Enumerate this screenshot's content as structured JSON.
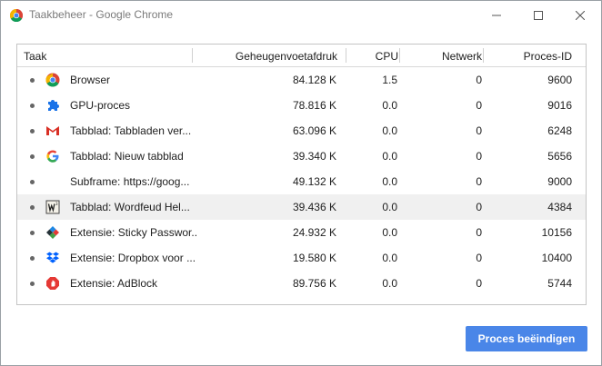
{
  "window": {
    "title": "Taakbeheer - Google Chrome"
  },
  "columns": {
    "task": "Taak",
    "memory": "Geheugenvoetafdruk",
    "cpu": "CPU",
    "network": "Netwerk",
    "pid": "Proces-ID"
  },
  "rows": [
    {
      "icon": "chrome-icon",
      "name": "Browser",
      "memory": "84.128 K",
      "cpu": "1.5",
      "network": "0",
      "pid": "9600"
    },
    {
      "icon": "puzzle-icon",
      "name": "GPU-proces",
      "memory": "78.816 K",
      "cpu": "0.0",
      "network": "0",
      "pid": "9016"
    },
    {
      "icon": "gmail-icon",
      "name": "Tabblad: Tabbladen ver...",
      "memory": "63.096 K",
      "cpu": "0.0",
      "network": "0",
      "pid": "6248"
    },
    {
      "icon": "google-icon",
      "name": "Tabblad: Nieuw tabblad",
      "memory": "39.340 K",
      "cpu": "0.0",
      "network": "0",
      "pid": "5656"
    },
    {
      "icon": "",
      "name": "Subframe: https://goog...",
      "memory": "49.132 K",
      "cpu": "0.0",
      "network": "0",
      "pid": "9000"
    },
    {
      "icon": "wordfeud-icon",
      "name": "Tabblad: Wordfeud Hel...",
      "memory": "39.436 K",
      "cpu": "0.0",
      "network": "0",
      "pid": "4384"
    },
    {
      "icon": "sticky-password-icon",
      "name": "Extensie: Sticky Passwor...",
      "memory": "24.932 K",
      "cpu": "0.0",
      "network": "0",
      "pid": "10156"
    },
    {
      "icon": "dropbox-icon",
      "name": "Extensie: Dropbox voor ...",
      "memory": "19.580 K",
      "cpu": "0.0",
      "network": "0",
      "pid": "10400"
    },
    {
      "icon": "adblock-icon",
      "name": "Extensie: AdBlock",
      "memory": "89.756 K",
      "cpu": "0.0",
      "network": "0",
      "pid": "5744"
    }
  ],
  "end_button": "Proces beëindigen",
  "colors": {
    "accent": "#4a86e8",
    "selected_row": "#f0f0f0"
  }
}
